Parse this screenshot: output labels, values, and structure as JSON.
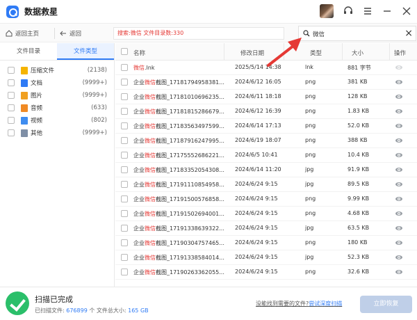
{
  "app": {
    "title": "数据救星"
  },
  "toolbar": {
    "home_label": "返回主页",
    "back_label": "返回",
    "search_summary_prefix": "搜索:",
    "search_summary_keyword": "微信",
    "search_summary_suffix": " 文件目录数:330",
    "search_value": "微信"
  },
  "left": {
    "tabs": [
      "文件目录",
      "文件类型"
    ],
    "categories": [
      {
        "label": "压缩文件",
        "count": "(2138)",
        "icon": "zip-icon",
        "color": "#f5b400"
      },
      {
        "label": "文档",
        "count": "(9999+)",
        "icon": "document-icon",
        "color": "#2f7bf5"
      },
      {
        "label": "图片",
        "count": "(9999+)",
        "icon": "image-icon",
        "color": "#f0a020"
      },
      {
        "label": "音频",
        "count": "(633)",
        "icon": "audio-icon",
        "color": "#f08a24"
      },
      {
        "label": "视频",
        "count": "(802)",
        "icon": "video-icon",
        "color": "#3f8df0"
      },
      {
        "label": "其他",
        "count": "(9999+)",
        "icon": "other-icon",
        "color": "#7f8fa6"
      }
    ]
  },
  "table": {
    "headers": {
      "name": "名称",
      "date": "修改日期",
      "type": "类型",
      "size": "大小",
      "action": "操作"
    },
    "rows": [
      {
        "pre": "",
        "hl": "微信",
        "post": ".lnk",
        "date": "2025/5/14 14:38",
        "type": "lnk",
        "size": "881 字节",
        "dim": true
      },
      {
        "pre": "企业",
        "hl": "微信",
        "post": "截图_17181794958381...",
        "date": "2024/6/12 16:05",
        "type": "png",
        "size": "381 KB"
      },
      {
        "pre": "企业",
        "hl": "微信",
        "post": "截图_17181010696235...",
        "date": "2024/6/11 18:18",
        "type": "png",
        "size": "128 KB"
      },
      {
        "pre": "企业",
        "hl": "微信",
        "post": "截图_17181815286679...",
        "date": "2024/6/12 16:39",
        "type": "png",
        "size": "1.83 KB"
      },
      {
        "pre": "企业",
        "hl": "微信",
        "post": "截图_17183563497599...",
        "date": "2024/6/14 17:13",
        "type": "png",
        "size": "52.0 KB"
      },
      {
        "pre": "企业",
        "hl": "微信",
        "post": "截图_17187916247995...",
        "date": "2024/6/19 18:07",
        "type": "png",
        "size": "388 KB"
      },
      {
        "pre": "企业",
        "hl": "微信",
        "post": "截图_17175552686221...",
        "date": "2024/6/5 10:41",
        "type": "png",
        "size": "10.4 KB"
      },
      {
        "pre": "企业",
        "hl": "微信",
        "post": "截图_17183352054308...",
        "date": "2024/6/14 11:20",
        "type": "jpg",
        "size": "91.9 KB"
      },
      {
        "pre": "企业",
        "hl": "微信",
        "post": "截图_17191110854958...",
        "date": "2024/6/24 9:15",
        "type": "jpg",
        "size": "89.5 KB"
      },
      {
        "pre": "企业",
        "hl": "微信",
        "post": "截图_17191500576858...",
        "date": "2024/6/24 9:15",
        "type": "png",
        "size": "9.99 KB"
      },
      {
        "pre": "企业",
        "hl": "微信",
        "post": "截图_17191502694001...",
        "date": "2024/6/24 9:15",
        "type": "png",
        "size": "4.68 KB"
      },
      {
        "pre": "企业",
        "hl": "微信",
        "post": "截图_17191338639322...",
        "date": "2024/6/24 9:15",
        "type": "jpg",
        "size": "63.5 KB"
      },
      {
        "pre": "企业",
        "hl": "微信",
        "post": "截图_17190304757465...",
        "date": "2024/6/24 9:15",
        "type": "png",
        "size": "180 KB"
      },
      {
        "pre": "企业",
        "hl": "微信",
        "post": "截图_17191338584014...",
        "date": "2024/6/24 9:15",
        "type": "jpg",
        "size": "52.3 KB"
      },
      {
        "pre": "企业",
        "hl": "微信",
        "post": "截图_17190263362055...",
        "date": "2024/6/24 9:15",
        "type": "png",
        "size": "32.6 KB"
      }
    ]
  },
  "footer": {
    "title": "扫描已完成",
    "scanned_label": "已扫描文件: ",
    "scanned_count": "676899",
    "mid_label": " 个 文件总大小: ",
    "total_size": "165 GB",
    "deep_link_prefix": "没能找到需要的文件?",
    "deep_link_action": "尝试深度扫描",
    "recover_label": "立即恢复"
  },
  "colors": {
    "accent": "#2f7bf5",
    "highlight": "#e53935",
    "success": "#2bbf6a"
  }
}
